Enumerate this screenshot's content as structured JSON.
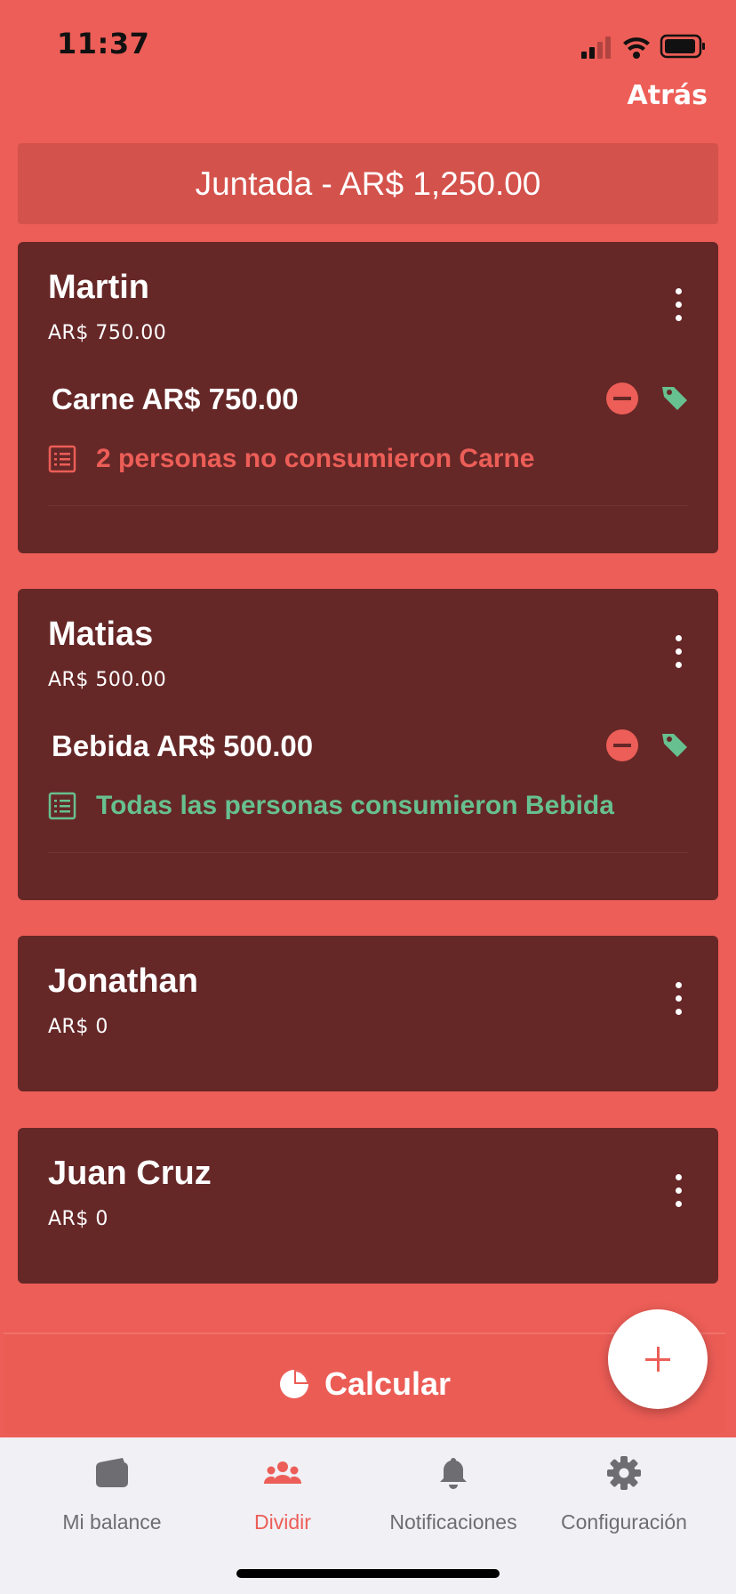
{
  "status_bar": {
    "time": "11:37"
  },
  "nav": {
    "back_label": "Atrás"
  },
  "header": {
    "title": "Juntada - AR$ 1,250.00"
  },
  "people": [
    {
      "name": "Martin",
      "amount": "AR$ 750.00",
      "items": [
        {
          "label": "Carne AR$ 750.00",
          "note": "2 personas no consumieron Carne",
          "note_color": "#EC5E57"
        }
      ]
    },
    {
      "name": "Matias",
      "amount": "AR$ 500.00",
      "items": [
        {
          "label": "Bebida AR$ 500.00",
          "note": "Todas las personas consumieron Bebida",
          "note_color": "#67C08F"
        }
      ]
    },
    {
      "name": "Jonathan",
      "amount": "AR$ 0",
      "items": []
    },
    {
      "name": "Juan Cruz",
      "amount": "AR$ 0",
      "items": []
    }
  ],
  "actions": {
    "calculate_label": "Calcular",
    "add_icon": "plus-icon"
  },
  "tabs": [
    {
      "label": "Mi balance",
      "icon": "wallet-icon",
      "active": false
    },
    {
      "label": "Dividir",
      "icon": "people-icon",
      "active": true
    },
    {
      "label": "Notificaciones",
      "icon": "bell-icon",
      "active": false
    },
    {
      "label": "Configuración",
      "icon": "gear-icon",
      "active": false
    }
  ],
  "colors": {
    "background": "#EC5E57",
    "card": "#662727",
    "header_box": "#D4524C",
    "accent_green": "#67C08F",
    "tabbar": "#F1F0F5"
  }
}
